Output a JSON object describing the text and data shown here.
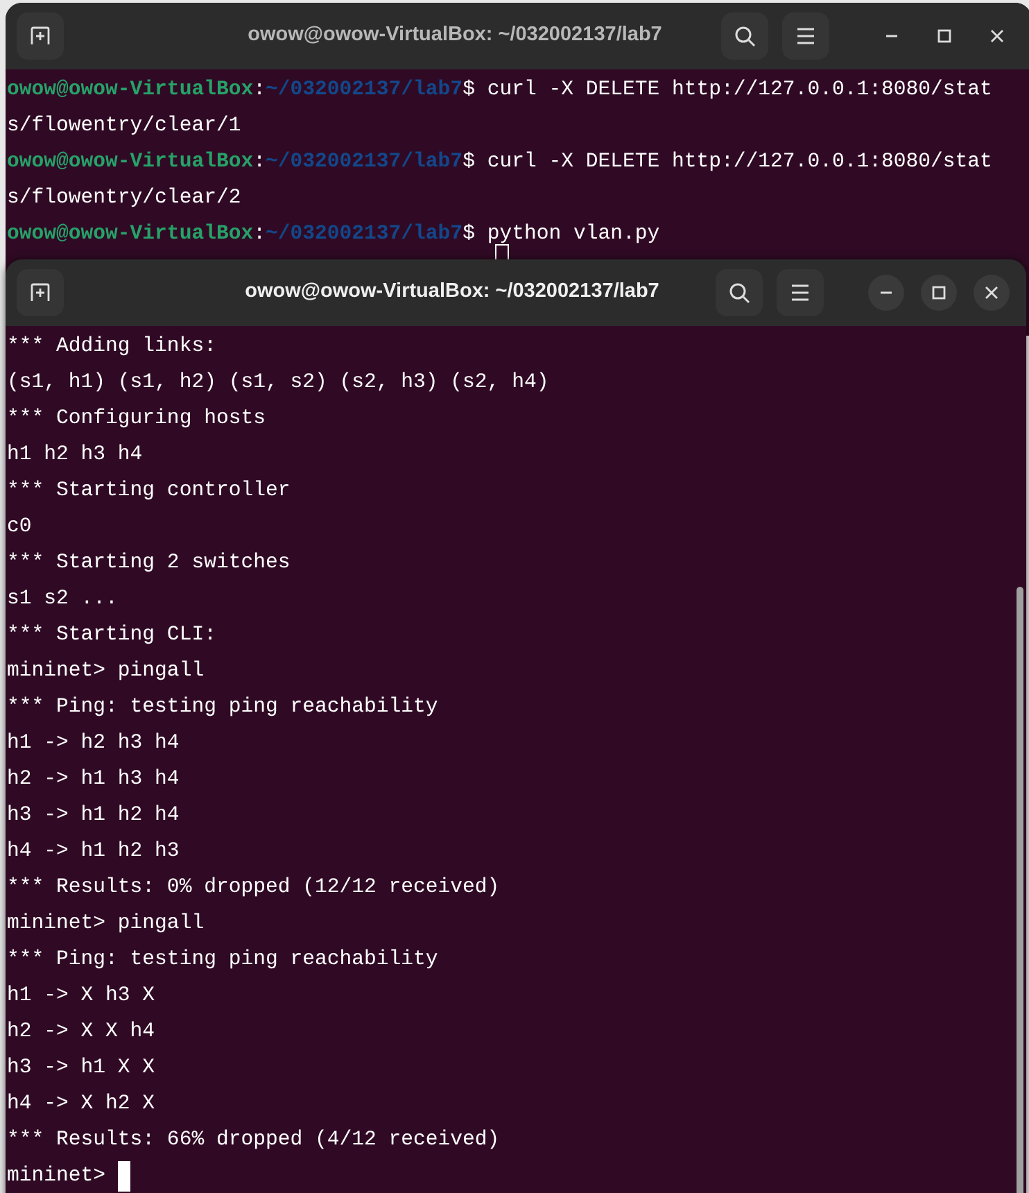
{
  "windows": [
    {
      "title": "owow@owow-VirtualBox: ~/032002137/lab7",
      "focused": false,
      "lines": [
        {
          "segments": [
            {
              "kind": "user",
              "text": "owow@owow-VirtualBox"
            },
            {
              "kind": "plain",
              "text": ":"
            },
            {
              "kind": "path",
              "text": "~/032002137/lab7"
            },
            {
              "kind": "plain",
              "text": "$ curl -X DELETE http://127.0.0.1:8080/stat"
            }
          ]
        },
        {
          "segments": [
            {
              "kind": "plain",
              "text": "s/flowentry/clear/1"
            }
          ]
        },
        {
          "segments": [
            {
              "kind": "user",
              "text": "owow@owow-VirtualBox"
            },
            {
              "kind": "plain",
              "text": ":"
            },
            {
              "kind": "path",
              "text": "~/032002137/lab7"
            },
            {
              "kind": "plain",
              "text": "$ curl -X DELETE http://127.0.0.1:8080/stat"
            }
          ]
        },
        {
          "segments": [
            {
              "kind": "plain",
              "text": "s/flowentry/clear/2"
            }
          ]
        },
        {
          "segments": [
            {
              "kind": "user",
              "text": "owow@owow-VirtualBox"
            },
            {
              "kind": "plain",
              "text": ":"
            },
            {
              "kind": "path",
              "text": "~/032002137/lab7"
            },
            {
              "kind": "plain",
              "text": "$ python vlan.py"
            }
          ],
          "cursor": true
        }
      ]
    },
    {
      "title": "owow@owow-VirtualBox: ~/032002137/lab7",
      "focused": true,
      "lines": [
        {
          "segments": [
            {
              "kind": "plain",
              "text": "*** Adding links:"
            }
          ]
        },
        {
          "segments": [
            {
              "kind": "plain",
              "text": "(s1, h1) (s1, h2) (s1, s2) (s2, h3) (s2, h4)"
            }
          ]
        },
        {
          "segments": [
            {
              "kind": "plain",
              "text": "*** Configuring hosts"
            }
          ]
        },
        {
          "segments": [
            {
              "kind": "plain",
              "text": "h1 h2 h3 h4"
            }
          ]
        },
        {
          "segments": [
            {
              "kind": "plain",
              "text": "*** Starting controller"
            }
          ]
        },
        {
          "segments": [
            {
              "kind": "plain",
              "text": "c0"
            }
          ]
        },
        {
          "segments": [
            {
              "kind": "plain",
              "text": "*** Starting 2 switches"
            }
          ]
        },
        {
          "segments": [
            {
              "kind": "plain",
              "text": "s1 s2 ..."
            }
          ]
        },
        {
          "segments": [
            {
              "kind": "plain",
              "text": "*** Starting CLI:"
            }
          ]
        },
        {
          "segments": [
            {
              "kind": "plain",
              "text": "mininet> pingall"
            }
          ]
        },
        {
          "segments": [
            {
              "kind": "plain",
              "text": "*** Ping: testing ping reachability"
            }
          ]
        },
        {
          "segments": [
            {
              "kind": "plain",
              "text": "h1 -> h2 h3 h4"
            }
          ]
        },
        {
          "segments": [
            {
              "kind": "plain",
              "text": "h2 -> h1 h3 h4"
            }
          ]
        },
        {
          "segments": [
            {
              "kind": "plain",
              "text": "h3 -> h1 h2 h4"
            }
          ]
        },
        {
          "segments": [
            {
              "kind": "plain",
              "text": "h4 -> h1 h2 h3"
            }
          ]
        },
        {
          "segments": [
            {
              "kind": "plain",
              "text": "*** Results: 0% dropped (12/12 received)"
            }
          ]
        },
        {
          "segments": [
            {
              "kind": "plain",
              "text": "mininet> pingall"
            }
          ]
        },
        {
          "segments": [
            {
              "kind": "plain",
              "text": "*** Ping: testing ping reachability"
            }
          ]
        },
        {
          "segments": [
            {
              "kind": "plain",
              "text": "h1 -> X h3 X"
            }
          ]
        },
        {
          "segments": [
            {
              "kind": "plain",
              "text": "h2 -> X X h4"
            }
          ]
        },
        {
          "segments": [
            {
              "kind": "plain",
              "text": "h3 -> h1 X X"
            }
          ]
        },
        {
          "segments": [
            {
              "kind": "plain",
              "text": "h4 -> X h2 X"
            }
          ]
        },
        {
          "segments": [
            {
              "kind": "plain",
              "text": "*** Results: 66% dropped (4/12 received)"
            }
          ]
        },
        {
          "segments": [
            {
              "kind": "plain",
              "text": "mininet> "
            }
          ],
          "cursor": true
        }
      ]
    }
  ]
}
